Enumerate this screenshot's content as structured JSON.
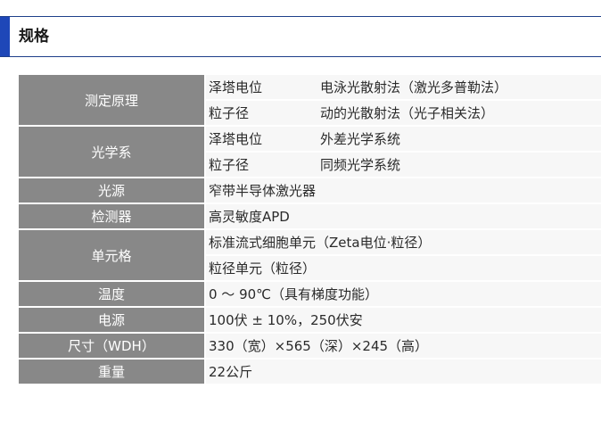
{
  "section": {
    "title": "规格"
  },
  "specs": {
    "principle": {
      "label": "测定原理",
      "rows": [
        {
          "sub": "泽塔电位",
          "value": "电泳光散射法（激光多普勒法）"
        },
        {
          "sub": "粒子径",
          "value": "动的光散射法（光子相关法）"
        }
      ]
    },
    "optics": {
      "label": "光学系",
      "rows": [
        {
          "sub": "泽塔电位",
          "value": "外差光学系统"
        },
        {
          "sub": "粒子径",
          "value": "同频光学系统"
        }
      ]
    },
    "light_source": {
      "label": "光源",
      "value": "窄带半导体激光器"
    },
    "detector": {
      "label": "检测器",
      "value": "高灵敏度APD"
    },
    "cell": {
      "label": "单元格",
      "values": [
        "标准流式细胞单元（Zeta电位·粒径）",
        "粒径单元（粒径）"
      ]
    },
    "temperature": {
      "label": "温度",
      "value": "0 ～ 90℃（具有梯度功能）"
    },
    "power": {
      "label": "电源",
      "value": "100伏 ± 10%，250伏安"
    },
    "dimensions": {
      "label": "尺寸（WDH）",
      "value": "330（宽）×565（深）×245（高）"
    },
    "weight": {
      "label": "重量",
      "value": "22公斤"
    }
  }
}
